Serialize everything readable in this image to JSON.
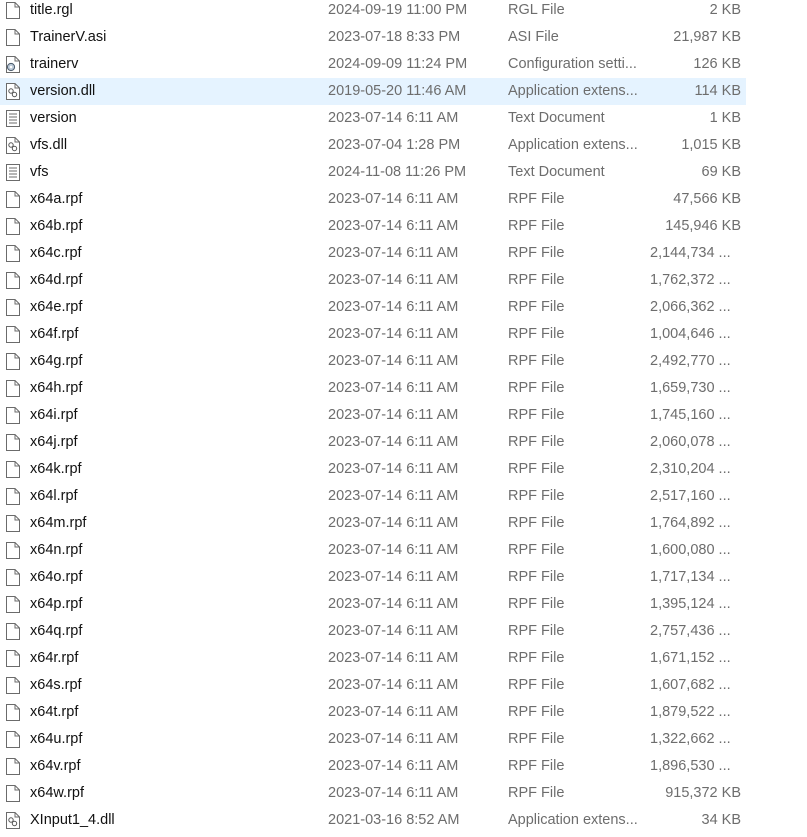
{
  "files": [
    {
      "name": "title.rgl",
      "date": "2024-09-19 11:00 PM",
      "type": "RGL File",
      "size": "2 KB",
      "icon": "generic-file-icon",
      "selected": false
    },
    {
      "name": "TrainerV.asi",
      "date": "2023-07-18 8:33 PM",
      "type": "ASI File",
      "size": "21,987 KB",
      "icon": "generic-file-icon",
      "selected": false
    },
    {
      "name": "trainerv",
      "date": "2024-09-09 11:24 PM",
      "type": "Configuration setti...",
      "size": "126 KB",
      "icon": "config-settings-icon",
      "selected": false
    },
    {
      "name": "version.dll",
      "date": "2019-05-20 11:46 AM",
      "type": "Application extens...",
      "size": "114 KB",
      "icon": "dll-file-icon",
      "selected": true
    },
    {
      "name": "version",
      "date": "2023-07-14 6:11 AM",
      "type": "Text Document",
      "size": "1 KB",
      "icon": "text-document-icon",
      "selected": false
    },
    {
      "name": "vfs.dll",
      "date": "2023-07-04 1:28 PM",
      "type": "Application extens...",
      "size": "1,015 KB",
      "icon": "dll-file-icon",
      "selected": false
    },
    {
      "name": "vfs",
      "date": "2024-11-08 11:26 PM",
      "type": "Text Document",
      "size": "69 KB",
      "icon": "text-document-icon",
      "selected": false
    },
    {
      "name": "x64a.rpf",
      "date": "2023-07-14 6:11 AM",
      "type": "RPF File",
      "size": "47,566 KB",
      "icon": "generic-file-icon",
      "selected": false
    },
    {
      "name": "x64b.rpf",
      "date": "2023-07-14 6:11 AM",
      "type": "RPF File",
      "size": "145,946 KB",
      "icon": "generic-file-icon",
      "selected": false
    },
    {
      "name": "x64c.rpf",
      "date": "2023-07-14 6:11 AM",
      "type": "RPF File",
      "size": "2,144,734 ...",
      "icon": "generic-file-icon",
      "selected": false
    },
    {
      "name": "x64d.rpf",
      "date": "2023-07-14 6:11 AM",
      "type": "RPF File",
      "size": "1,762,372 ...",
      "icon": "generic-file-icon",
      "selected": false
    },
    {
      "name": "x64e.rpf",
      "date": "2023-07-14 6:11 AM",
      "type": "RPF File",
      "size": "2,066,362 ...",
      "icon": "generic-file-icon",
      "selected": false
    },
    {
      "name": "x64f.rpf",
      "date": "2023-07-14 6:11 AM",
      "type": "RPF File",
      "size": "1,004,646 ...",
      "icon": "generic-file-icon",
      "selected": false
    },
    {
      "name": "x64g.rpf",
      "date": "2023-07-14 6:11 AM",
      "type": "RPF File",
      "size": "2,492,770 ...",
      "icon": "generic-file-icon",
      "selected": false
    },
    {
      "name": "x64h.rpf",
      "date": "2023-07-14 6:11 AM",
      "type": "RPF File",
      "size": "1,659,730 ...",
      "icon": "generic-file-icon",
      "selected": false
    },
    {
      "name": "x64i.rpf",
      "date": "2023-07-14 6:11 AM",
      "type": "RPF File",
      "size": "1,745,160 ...",
      "icon": "generic-file-icon",
      "selected": false
    },
    {
      "name": "x64j.rpf",
      "date": "2023-07-14 6:11 AM",
      "type": "RPF File",
      "size": "2,060,078 ...",
      "icon": "generic-file-icon",
      "selected": false
    },
    {
      "name": "x64k.rpf",
      "date": "2023-07-14 6:11 AM",
      "type": "RPF File",
      "size": "2,310,204 ...",
      "icon": "generic-file-icon",
      "selected": false
    },
    {
      "name": "x64l.rpf",
      "date": "2023-07-14 6:11 AM",
      "type": "RPF File",
      "size": "2,517,160 ...",
      "icon": "generic-file-icon",
      "selected": false
    },
    {
      "name": "x64m.rpf",
      "date": "2023-07-14 6:11 AM",
      "type": "RPF File",
      "size": "1,764,892 ...",
      "icon": "generic-file-icon",
      "selected": false
    },
    {
      "name": "x64n.rpf",
      "date": "2023-07-14 6:11 AM",
      "type": "RPF File",
      "size": "1,600,080 ...",
      "icon": "generic-file-icon",
      "selected": false
    },
    {
      "name": "x64o.rpf",
      "date": "2023-07-14 6:11 AM",
      "type": "RPF File",
      "size": "1,717,134 ...",
      "icon": "generic-file-icon",
      "selected": false
    },
    {
      "name": "x64p.rpf",
      "date": "2023-07-14 6:11 AM",
      "type": "RPF File",
      "size": "1,395,124 ...",
      "icon": "generic-file-icon",
      "selected": false
    },
    {
      "name": "x64q.rpf",
      "date": "2023-07-14 6:11 AM",
      "type": "RPF File",
      "size": "2,757,436 ...",
      "icon": "generic-file-icon",
      "selected": false
    },
    {
      "name": "x64r.rpf",
      "date": "2023-07-14 6:11 AM",
      "type": "RPF File",
      "size": "1,671,152 ...",
      "icon": "generic-file-icon",
      "selected": false
    },
    {
      "name": "x64s.rpf",
      "date": "2023-07-14 6:11 AM",
      "type": "RPF File",
      "size": "1,607,682 ...",
      "icon": "generic-file-icon",
      "selected": false
    },
    {
      "name": "x64t.rpf",
      "date": "2023-07-14 6:11 AM",
      "type": "RPF File",
      "size": "1,879,522 ...",
      "icon": "generic-file-icon",
      "selected": false
    },
    {
      "name": "x64u.rpf",
      "date": "2023-07-14 6:11 AM",
      "type": "RPF File",
      "size": "1,322,662 ...",
      "icon": "generic-file-icon",
      "selected": false
    },
    {
      "name": "x64v.rpf",
      "date": "2023-07-14 6:11 AM",
      "type": "RPF File",
      "size": "1,896,530 ...",
      "icon": "generic-file-icon",
      "selected": false
    },
    {
      "name": "x64w.rpf",
      "date": "2023-07-14 6:11 AM",
      "type": "RPF File",
      "size": "915,372 KB",
      "icon": "generic-file-icon",
      "selected": false
    },
    {
      "name": "XInput1_4.dll",
      "date": "2021-03-16 8:52 AM",
      "type": "Application extens...",
      "size": "34 KB",
      "icon": "dll-file-icon",
      "selected": false
    }
  ],
  "colors": {
    "selected_row_bg": "#e5f3ff",
    "name_text": "#111111",
    "detail_text": "#6d6d6d"
  }
}
